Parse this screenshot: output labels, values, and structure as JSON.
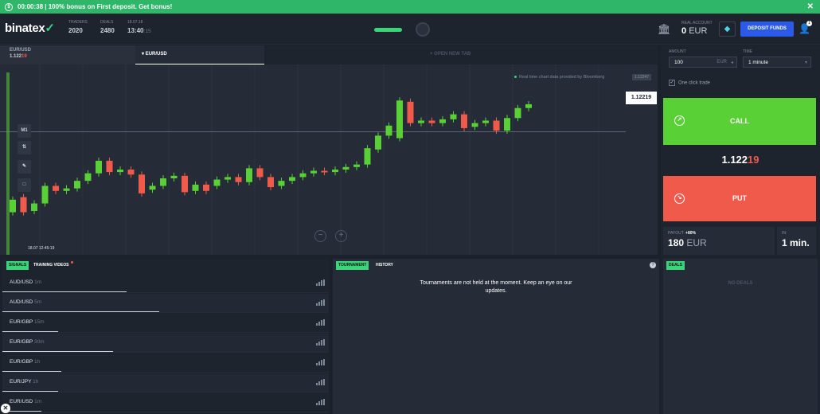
{
  "banner": {
    "timer": "00:00:38",
    "text": "| 100% bonus on First deposit. Get bonus!",
    "close": "✕"
  },
  "header": {
    "logo": "binatex",
    "traders_label": "TRADERS",
    "traders_value": "2020",
    "deals_label": "DEALS",
    "deals_value": "2480",
    "date_label": "18.07.18",
    "time_value": "13:40",
    "time_seconds": ":15",
    "account_label": "REAL ACCOUNT",
    "balance": "0",
    "currency": "EUR",
    "deposit_label": "DEPOSIT FUNDS",
    "notification_count": "1"
  },
  "tabs": {
    "tab1_pair": "EUR/USD",
    "tab1_price_main": "1.122",
    "tab1_price_tail": "19",
    "tab2_label": "EUR/USD",
    "new_tab": "+ OPEN NEW TAB"
  },
  "chart": {
    "provider": "Real time chart data provided by Bloomberg",
    "provider_price": "1.12247",
    "current_price": "1.12219",
    "timeframe": "M1",
    "time_label": "18.07 12:45:19"
  },
  "chart_data": {
    "type": "candlestick",
    "candles": [
      {
        "o": 1.12155,
        "c": 1.12165,
        "up": true
      },
      {
        "o": 1.12167,
        "c": 1.12155,
        "up": false
      },
      {
        "o": 1.12156,
        "c": 1.12162,
        "up": true
      },
      {
        "o": 1.12162,
        "c": 1.12176,
        "up": true
      },
      {
        "o": 1.12176,
        "c": 1.12172,
        "up": false
      },
      {
        "o": 1.12172,
        "c": 1.12174,
        "up": true
      },
      {
        "o": 1.12174,
        "c": 1.1218,
        "up": true
      },
      {
        "o": 1.1218,
        "c": 1.12186,
        "up": true
      },
      {
        "o": 1.12186,
        "c": 1.12196,
        "up": true
      },
      {
        "o": 1.12196,
        "c": 1.12187,
        "up": false
      },
      {
        "o": 1.12187,
        "c": 1.12189,
        "up": true
      },
      {
        "o": 1.12189,
        "c": 1.12185,
        "up": false
      },
      {
        "o": 1.12185,
        "c": 1.1217,
        "up": false
      },
      {
        "o": 1.12173,
        "c": 1.12176,
        "up": true
      },
      {
        "o": 1.12176,
        "c": 1.12182,
        "up": true
      },
      {
        "o": 1.12182,
        "c": 1.12184,
        "up": true
      },
      {
        "o": 1.12184,
        "c": 1.12171,
        "up": false
      },
      {
        "o": 1.12172,
        "c": 1.12177,
        "up": true
      },
      {
        "o": 1.12177,
        "c": 1.12172,
        "up": false
      },
      {
        "o": 1.12176,
        "c": 1.12181,
        "up": true
      },
      {
        "o": 1.12181,
        "c": 1.12183,
        "up": true
      },
      {
        "o": 1.12183,
        "c": 1.12179,
        "up": false
      },
      {
        "o": 1.12179,
        "c": 1.1219,
        "up": true
      },
      {
        "o": 1.1219,
        "c": 1.12183,
        "up": false
      },
      {
        "o": 1.12183,
        "c": 1.12175,
        "up": false
      },
      {
        "o": 1.12176,
        "c": 1.1218,
        "up": true
      },
      {
        "o": 1.1218,
        "c": 1.12183,
        "up": true
      },
      {
        "o": 1.12183,
        "c": 1.12186,
        "up": true
      },
      {
        "o": 1.12186,
        "c": 1.12188,
        "up": true
      },
      {
        "o": 1.12188,
        "c": 1.12187,
        "up": false
      },
      {
        "o": 1.12187,
        "c": 1.12189,
        "up": true
      },
      {
        "o": 1.12189,
        "c": 1.12191,
        "up": true
      },
      {
        "o": 1.12191,
        "c": 1.12193,
        "up": true
      },
      {
        "o": 1.12193,
        "c": 1.12206,
        "up": true
      },
      {
        "o": 1.12205,
        "c": 1.12216,
        "up": true
      },
      {
        "o": 1.12216,
        "c": 1.12224,
        "up": true
      },
      {
        "o": 1.12214,
        "c": 1.12244,
        "up": true
      },
      {
        "o": 1.12243,
        "c": 1.12226,
        "up": false
      },
      {
        "o": 1.12226,
        "c": 1.12228,
        "up": true
      },
      {
        "o": 1.12228,
        "c": 1.12226,
        "up": false
      },
      {
        "o": 1.12226,
        "c": 1.12229,
        "up": true
      },
      {
        "o": 1.12229,
        "c": 1.12233,
        "up": true
      },
      {
        "o": 1.12233,
        "c": 1.12222,
        "up": false
      },
      {
        "o": 1.12223,
        "c": 1.12226,
        "up": true
      },
      {
        "o": 1.12226,
        "c": 1.12228,
        "up": true
      },
      {
        "o": 1.12228,
        "c": 1.1222,
        "up": false
      },
      {
        "o": 1.1222,
        "c": 1.1223,
        "up": true
      },
      {
        "o": 1.1223,
        "c": 1.12238,
        "up": true
      },
      {
        "o": 1.12238,
        "c": 1.12241,
        "up": true
      }
    ],
    "ylim": [
      1.1213,
      1.1226
    ]
  },
  "tools": {
    "draw": "✎",
    "shape": "□",
    "indicator": "⇅"
  },
  "zoom": {
    "minus": "−",
    "plus": "+"
  },
  "trade": {
    "amount_label": "AMOUNT",
    "amount_value": "100",
    "amount_currency": "EUR",
    "time_label": "TIME",
    "time_value": "1 minute",
    "one_click": "One click trade",
    "call": "CALL",
    "put": "PUT",
    "price_main": "1.122",
    "price_tail": "19",
    "payout_label": "PAYOUT:",
    "payout_pct": "+80%",
    "payout_value": "180",
    "payout_currency": "EUR",
    "in_label": "IN:",
    "in_value": "1 min."
  },
  "signals": {
    "tab_signals": "SIGNALS",
    "tab_training": "TRAINING VIDEOS",
    "rows": [
      {
        "pair": "AUD/USD",
        "tf": "1m",
        "bar": 0.38
      },
      {
        "pair": "AUD/USD",
        "tf": "5m",
        "bar": 0.48
      },
      {
        "pair": "EUR/GBP",
        "tf": "15m",
        "bar": 0.17
      },
      {
        "pair": "EUR/GBP",
        "tf": "30m",
        "bar": 0.34
      },
      {
        "pair": "EUR/GBP",
        "tf": "1h",
        "bar": 0.18
      },
      {
        "pair": "EUR/JPY",
        "tf": "1h",
        "bar": 0.17
      },
      {
        "pair": "EUR/USD",
        "tf": "1m",
        "bar": 0.12
      }
    ]
  },
  "tournament": {
    "tab_tournament": "TOURNAMENT",
    "tab_history": "HISTORY",
    "message": "Tournaments are not held at the moment. Keep an eye on our updates."
  },
  "deals": {
    "tab_label": "DEALS",
    "empty": "NO DEALS"
  },
  "colors": {
    "up": "#5ad037",
    "down": "#f05a4b",
    "accent": "#3ad47a",
    "deposit": "#2b5ae8"
  }
}
